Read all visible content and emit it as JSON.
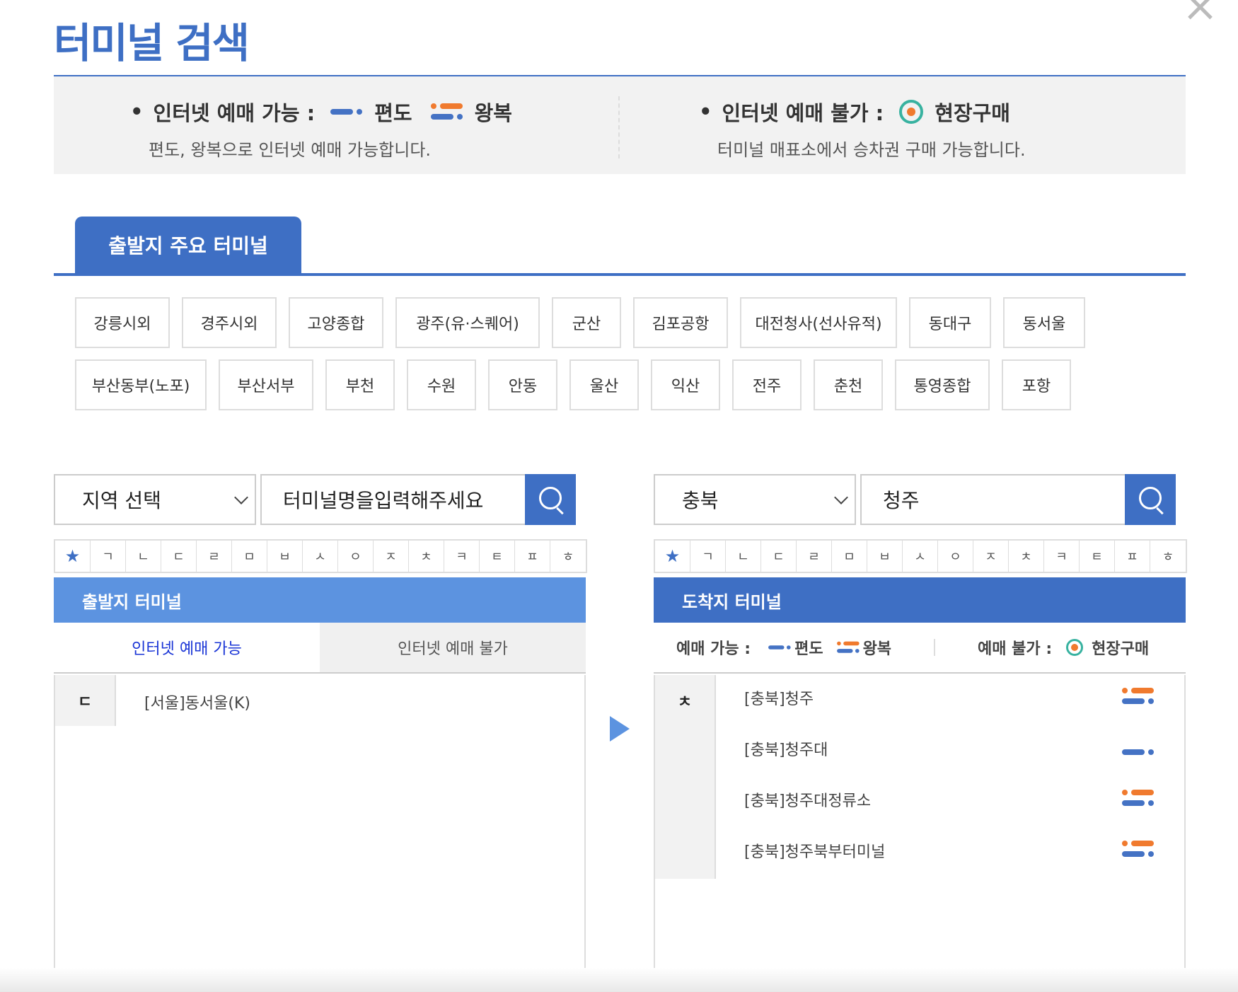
{
  "title": "터미널 검색",
  "info": {
    "left": {
      "bullet": "•",
      "label": "인터넷 예매 가능 :",
      "oneway": "편도",
      "roundtrip": "왕복",
      "desc": "편도, 왕복으로 인터넷 예매 가능합니다."
    },
    "right": {
      "bullet": "•",
      "label": "인터넷 예매 불가 :",
      "onsite": "현장구매",
      "desc": "터미널 매표소에서 승차권 구매 가능합니다."
    }
  },
  "major_tab": "출발지 주요 터미널",
  "major_terminals_row1": [
    "강릉시외",
    "경주시외",
    "고양종합",
    "광주(유·스퀘어)",
    "군산",
    "김포공항",
    "대전청사(선사유적)",
    "동대구",
    "동서울"
  ],
  "major_terminals_row2": [
    "부산동부(노포)",
    "부산서부",
    "부천",
    "수원",
    "안동",
    "울산",
    "익산",
    "전주",
    "춘천",
    "통영종합",
    "포항"
  ],
  "consonants": [
    "★",
    "ㄱ",
    "ㄴ",
    "ㄷ",
    "ㄹ",
    "ㅁ",
    "ㅂ",
    "ㅅ",
    "ㅇ",
    "ㅈ",
    "ㅊ",
    "ㅋ",
    "ㅌ",
    "ㅍ",
    "ㅎ"
  ],
  "departure": {
    "region": "지역 선택",
    "search_text": "터미널명을입력해주세요",
    "header": "출발지 터미널",
    "tab_on": "인터넷 예매 가능",
    "tab_off": "인터넷 예매 불가",
    "index": "ㄷ",
    "items": [
      "[서울]동서울(K)"
    ]
  },
  "arrival": {
    "region": "충북",
    "search_text": "청주",
    "header": "도착지 터미널",
    "legend": {
      "avail": "예매 가능 :",
      "oneway": "편도",
      "roundtrip": "왕복",
      "unavail": "예매 불가 :",
      "onsite": "현장구매"
    },
    "index": "ㅊ",
    "items": [
      {
        "name": "[충북]청주",
        "type": "round-trip-icon"
      },
      {
        "name": "[충북]청주대",
        "type": "one-way-icon"
      },
      {
        "name": "[충북]청주대정류소",
        "type": "round-trip-icon"
      },
      {
        "name": "[충북]청주북부터미널",
        "type": "round-trip-icon"
      }
    ]
  },
  "colors": {
    "accent": "#3e6fc4",
    "light_accent": "#5c93e0",
    "orange": "#f07a2e",
    "teal": "#38b2a0"
  }
}
